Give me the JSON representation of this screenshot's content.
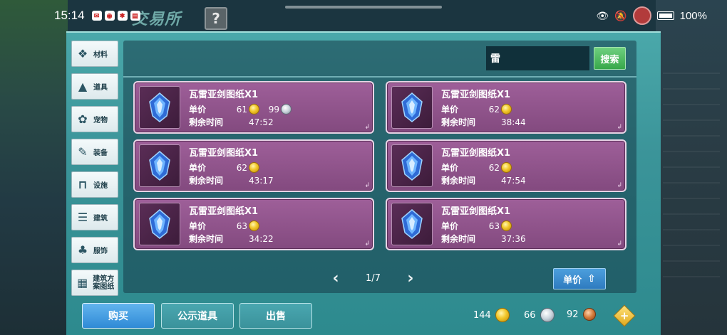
{
  "status_bar": {
    "time": "15:14",
    "battery": "100%"
  },
  "window": {
    "title": "交易所",
    "help_label": "?"
  },
  "sidebar": {
    "items": [
      {
        "label": "材料",
        "icon": "material-icon"
      },
      {
        "label": "道具",
        "icon": "item-icon"
      },
      {
        "label": "宠物",
        "icon": "paw-icon"
      },
      {
        "label": "装备",
        "icon": "equipment-icon"
      },
      {
        "label": "设施",
        "icon": "facility-icon"
      },
      {
        "label": "建筑",
        "icon": "building-icon"
      },
      {
        "label": "服饰",
        "icon": "clothing-icon"
      },
      {
        "label": "建筑方案图纸",
        "icon": "blueprint-icon"
      }
    ]
  },
  "search": {
    "value": "雷",
    "button_label": "搜索"
  },
  "listing_labels": {
    "price": "单价",
    "remaining": "剩余时间"
  },
  "listings": [
    {
      "name": "瓦雷亚剑图纸X1",
      "price_gold": "61",
      "price_silver": "99",
      "time": "47:52"
    },
    {
      "name": "瓦雷亚剑图纸X1",
      "price_gold": "62",
      "price_silver": "",
      "time": "38:44"
    },
    {
      "name": "瓦雷亚剑图纸X1",
      "price_gold": "62",
      "price_silver": "",
      "time": "43:17"
    },
    {
      "name": "瓦雷亚剑图纸X1",
      "price_gold": "62",
      "price_silver": "",
      "time": "47:54"
    },
    {
      "name": "瓦雷亚剑图纸X1",
      "price_gold": "63",
      "price_silver": "",
      "time": "34:22"
    },
    {
      "name": "瓦雷亚剑图纸X1",
      "price_gold": "63",
      "price_silver": "",
      "time": "37:36"
    }
  ],
  "pagination": {
    "page": "1/7"
  },
  "sort": {
    "label": "单价"
  },
  "tabs": {
    "buy": "购买",
    "public": "公示道具",
    "sell": "出售"
  },
  "currency": {
    "gold": "144",
    "silver": "66",
    "bronze": "92"
  },
  "colors": {
    "card": "#8f5389",
    "accent_blue": "#2f8ad6",
    "search_green": "#37a84a",
    "panel_teal": "#3b9499"
  }
}
